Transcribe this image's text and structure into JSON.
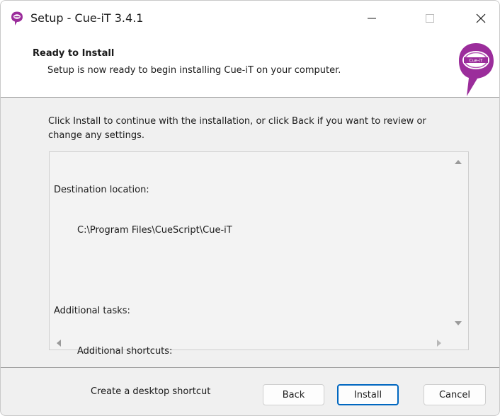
{
  "window": {
    "title": "Setup - Cue-iT 3.4.1",
    "accent_color": "#0067c0",
    "brand_color": "#9b2d9b"
  },
  "titlebar": {
    "icons": [
      "app-icon",
      "minimize-icon",
      "maximize-icon",
      "close-icon"
    ]
  },
  "header": {
    "title": "Ready to Install",
    "subtitle": "Setup is now ready to begin installing Cue-iT on your computer.",
    "logo_text": "Cue-iT"
  },
  "body": {
    "intro_line1": "Click Install to continue with the installation, or click Back if you want to review or",
    "intro_line2": "change any settings.",
    "memo": {
      "destination_heading": "Destination location:",
      "destination_path": "C:\\Program Files\\CueScript\\Cue-iT",
      "tasks_heading": "Additional tasks:",
      "shortcuts_heading": "Additional shortcuts:",
      "shortcut_item": "Create a desktop shortcut"
    }
  },
  "buttons": {
    "back": "Back",
    "install": "Install",
    "cancel": "Cancel"
  }
}
